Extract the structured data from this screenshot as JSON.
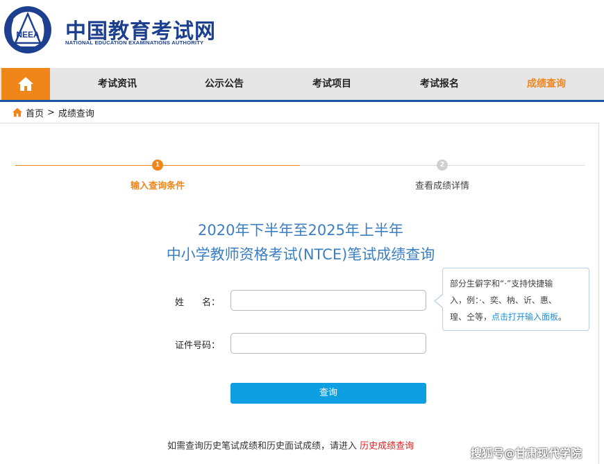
{
  "header": {
    "logo_cn": "中国教育考试网",
    "logo_en": "NATIONAL EDUCATION EXAMINATIONS AUTHORITY",
    "emblem_text": "NEEA"
  },
  "nav": {
    "home_icon": "home-icon",
    "items": [
      {
        "label": "考试资讯"
      },
      {
        "label": "公示公告"
      },
      {
        "label": "考试项目"
      },
      {
        "label": "考试报名"
      },
      {
        "label": "成绩查询"
      }
    ],
    "active_color": "#f0851a",
    "brand_color": "#1b56a5"
  },
  "breadcrumb": {
    "home": "首页",
    "separator": ">",
    "current": "成绩查询"
  },
  "steps": [
    {
      "number": "1",
      "label": "输入查询条件"
    },
    {
      "number": "2",
      "label": "查看成绩详情"
    }
  ],
  "title": {
    "line1": "2020年下半年至2025年上半年",
    "line2": "中小学教师资格考试(NTCE)笔试成绩查询"
  },
  "form": {
    "name_label": "姓　　名：",
    "name_value": "",
    "id_label": "证件号码：",
    "id_value": "",
    "submit_label": "查询"
  },
  "tooltip": {
    "line1": "部分生僻字和“·”支持快捷输",
    "line2": "入，例：·、奕、枘、䜣、惠、",
    "line3_prefix": "瑝、仝等，",
    "line3_link": "点击打开输入面板",
    "line3_suffix": "。"
  },
  "footer": {
    "note": "如需查询历史笔试成绩和历史面试成绩，请进入",
    "link": "历史成绩查询"
  },
  "watermark": "搜狐号@甘肃现代学院"
}
